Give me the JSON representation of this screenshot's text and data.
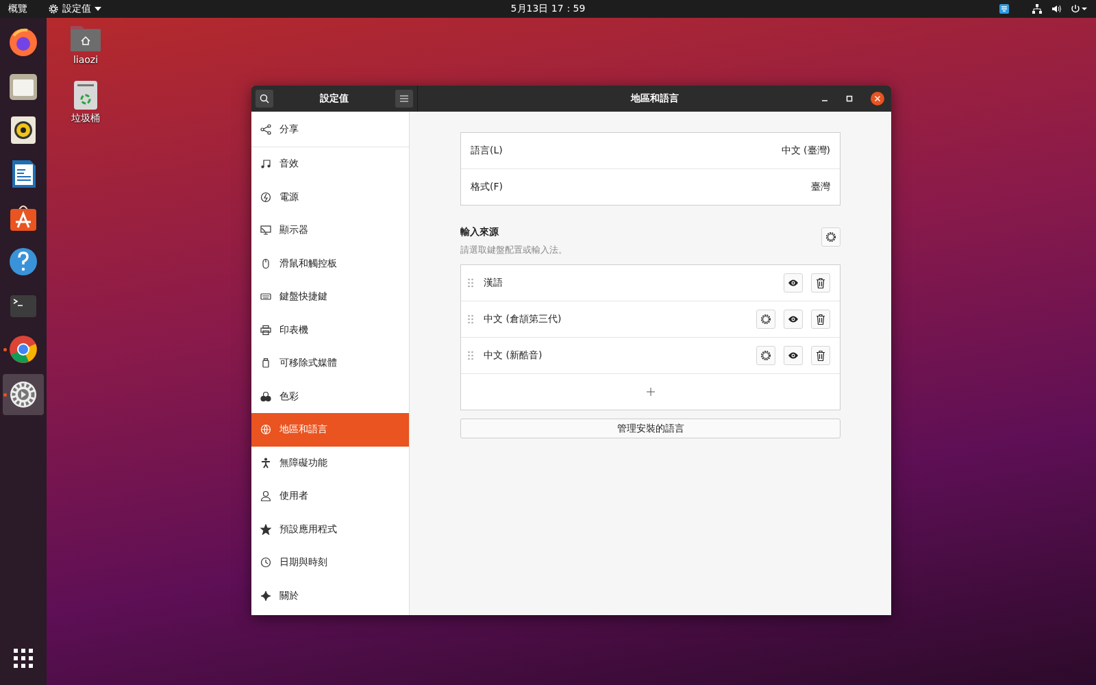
{
  "top_bar": {
    "activities": "概覽",
    "app_menu": "設定值",
    "clock": "5月13日  17：59"
  },
  "dock": [
    {
      "kind": "firefox",
      "running": false,
      "selected": false
    },
    {
      "kind": "files",
      "running": false,
      "selected": false
    },
    {
      "kind": "rhythmbox",
      "running": false,
      "selected": false
    },
    {
      "kind": "writer",
      "running": false,
      "selected": false
    },
    {
      "kind": "software",
      "running": false,
      "selected": false
    },
    {
      "kind": "help",
      "running": false,
      "selected": false
    },
    {
      "kind": "terminal",
      "running": false,
      "selected": false
    },
    {
      "kind": "chrome",
      "running": true,
      "selected": false
    },
    {
      "kind": "settings",
      "running": true,
      "selected": true
    }
  ],
  "desktop_icons": [
    {
      "kind": "home",
      "label": "liaozi"
    },
    {
      "kind": "trash",
      "label": "垃圾桶"
    }
  ],
  "window": {
    "sidebar_title": "設定值",
    "title": "地區和語言"
  },
  "sidebar": {
    "items": [
      {
        "label": "分享",
        "selected": false
      },
      {
        "label": "音效",
        "selected": false
      },
      {
        "label": "電源",
        "selected": false
      },
      {
        "label": "顯示器",
        "selected": false
      },
      {
        "label": "滑鼠和觸控板",
        "selected": false
      },
      {
        "label": "鍵盤快捷鍵",
        "selected": false
      },
      {
        "label": "印表機",
        "selected": false
      },
      {
        "label": "可移除式媒體",
        "selected": false
      },
      {
        "label": "色彩",
        "selected": false
      },
      {
        "label": "地區和語言",
        "selected": true
      },
      {
        "label": "無障礙功能",
        "selected": false
      },
      {
        "label": "使用者",
        "selected": false
      },
      {
        "label": "預設應用程式",
        "selected": false
      },
      {
        "label": "日期與時刻",
        "selected": false
      },
      {
        "label": "關於",
        "selected": false
      }
    ]
  },
  "language_settings": [
    {
      "label": "語言(L)",
      "value": "中文 (臺灣)"
    },
    {
      "label": "格式(F)",
      "value": "臺灣"
    }
  ],
  "input_sources": {
    "title": "輸入來源",
    "subtitle": "請選取鍵盤配置或輸入法。",
    "items": [
      {
        "name": "漢語",
        "configurable": false
      },
      {
        "name": "中文 (倉頡第三代)",
        "configurable": true
      },
      {
        "name": "中文 (新酷音)",
        "configurable": true
      }
    ]
  },
  "manage_button": "管理安裝的語言"
}
